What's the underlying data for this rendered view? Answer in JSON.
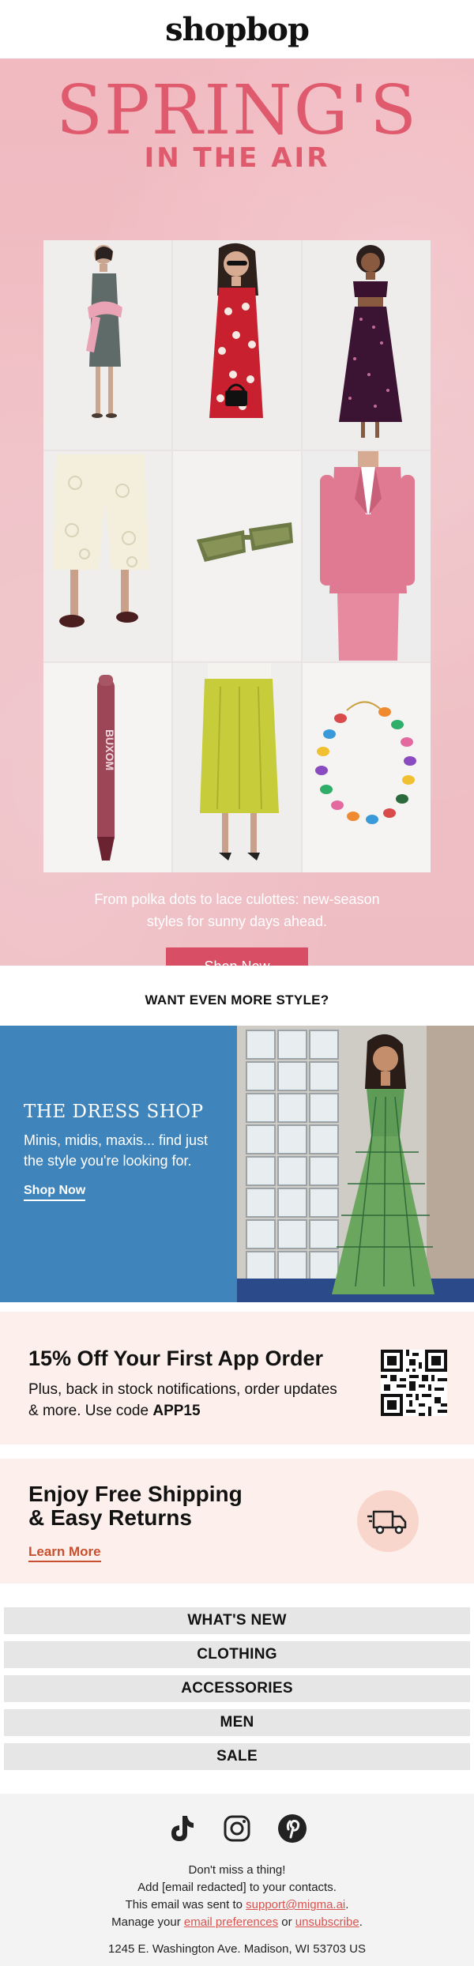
{
  "header": {
    "logo_text": "shopbop"
  },
  "hero": {
    "title_line1": "SPRING'S",
    "title_line2": "IN THE AIR",
    "products": [
      "dress-tie-sweater",
      "polka-dot-dress",
      "polka-dot-set",
      "lace-culottes",
      "sunglasses",
      "pink-suit",
      "lip-liner",
      "yellow-skirt",
      "bead-necklace"
    ],
    "lip_brand": "BUXOM",
    "description_line1": "From polka dots to lace culottes: new-season",
    "description_line2": "styles for sunny days ahead.",
    "cta_label": "Shop Now"
  },
  "want_more": {
    "heading": "WANT EVEN MORE STYLE?"
  },
  "dress_shop": {
    "title": "THE DRESS SHOP",
    "text": "Minis, midis, maxis... find just the style you're looking for.",
    "link": "Shop Now"
  },
  "app_promo": {
    "title": "15% Off Your First App Order",
    "text_before": "Plus, back in stock notifications, order updates & more. Use code ",
    "code": "APP15"
  },
  "shipping": {
    "title_line1": "Enjoy Free Shipping",
    "title_line2": "& Easy Returns",
    "link": "Learn More"
  },
  "nav": {
    "items": [
      "WHAT'S NEW",
      "CLOTHING",
      "ACCESSORIES",
      "MEN",
      "SALE"
    ]
  },
  "footer": {
    "social_icons": [
      "tiktok-icon",
      "instagram-icon",
      "pinterest-icon"
    ],
    "line1": "Don't miss a thing!",
    "line2": "Add [email redacted] to your contacts.",
    "line3_before": "This email was sent to ",
    "email": "support@migma.ai",
    "line3_after": ".",
    "line4_before": "Manage your ",
    "prefs_link": "email preferences",
    "line4_or": " or ",
    "unsub_link": "unsubscribe",
    "line4_after": ".",
    "address": "1245 E. Washington Ave. Madison, WI 53703 US"
  },
  "colors": {
    "accent": "#d84e65",
    "title_pink": "#e05a6d",
    "dress_blue": "#3f84ba",
    "promo_bg": "#fdf0ec",
    "link_orange": "#c8502e"
  }
}
